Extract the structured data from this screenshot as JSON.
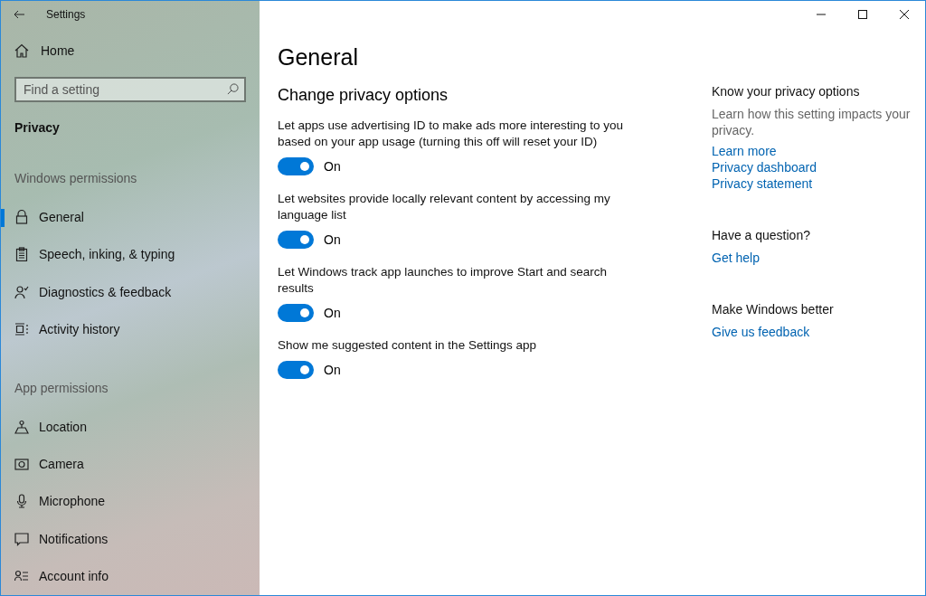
{
  "window": {
    "title": "Settings"
  },
  "sidebar": {
    "home": "Home",
    "search": {
      "placeholder": "Find a setting"
    },
    "category": "Privacy",
    "groups": [
      {
        "heading": "Windows permissions",
        "items": [
          {
            "label": "General",
            "selected": true
          },
          {
            "label": "Speech, inking, & typing",
            "selected": false
          },
          {
            "label": "Diagnostics & feedback",
            "selected": false
          },
          {
            "label": "Activity history",
            "selected": false
          }
        ]
      },
      {
        "heading": "App permissions",
        "items": [
          {
            "label": "Location",
            "selected": false
          },
          {
            "label": "Camera",
            "selected": false
          },
          {
            "label": "Microphone",
            "selected": false
          },
          {
            "label": "Notifications",
            "selected": false
          },
          {
            "label": "Account info",
            "selected": false
          }
        ]
      }
    ]
  },
  "page": {
    "title": "General",
    "section": "Change privacy options",
    "settings": [
      {
        "description": "Let apps use advertising ID to make ads more interesting to you based on your app usage (turning this off will reset your ID)",
        "on": true,
        "state": "On"
      },
      {
        "description": "Let websites provide locally relevant content by accessing my language list",
        "on": true,
        "state": "On"
      },
      {
        "description": "Let Windows track app launches to improve Start and search results",
        "on": true,
        "state": "On"
      },
      {
        "description": "Show me suggested content in the Settings app",
        "on": true,
        "state": "On"
      }
    ]
  },
  "aside": [
    {
      "title": "Know your privacy options",
      "description": "Learn how this setting impacts your privacy.",
      "links": [
        "Learn more",
        "Privacy dashboard",
        "Privacy statement"
      ]
    },
    {
      "title": "Have a question?",
      "links": [
        "Get help"
      ]
    },
    {
      "title": "Make Windows better",
      "links": [
        "Give us feedback"
      ]
    }
  ]
}
